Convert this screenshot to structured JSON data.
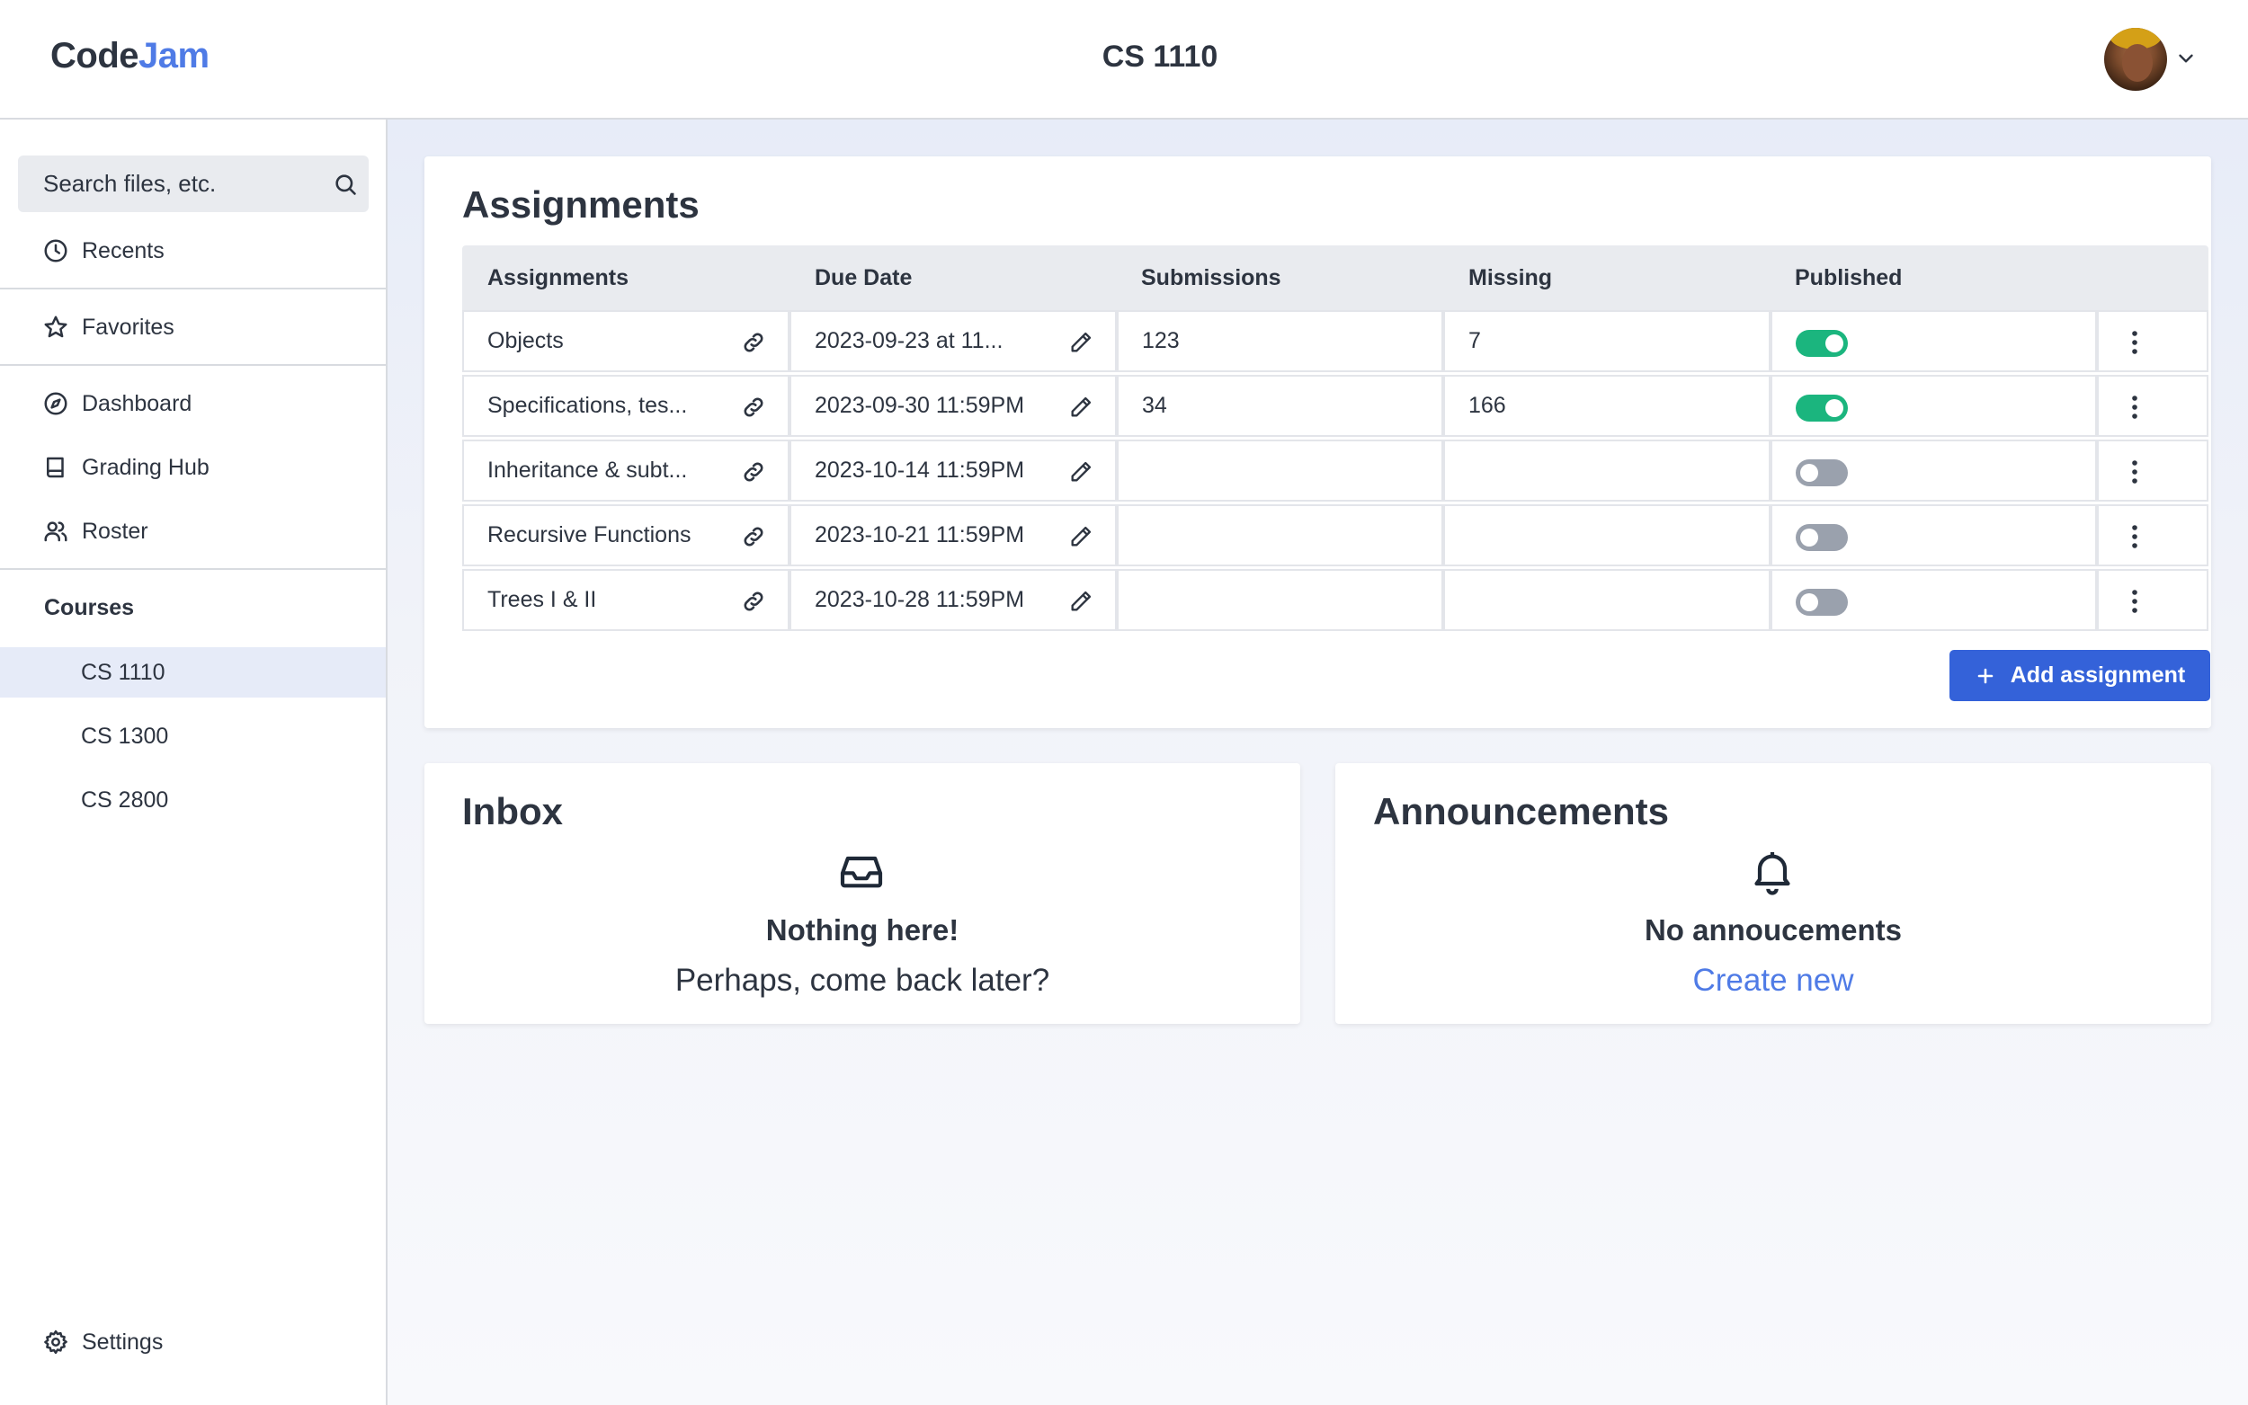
{
  "header": {
    "logo_part1": "Code",
    "logo_part2": "Jam",
    "course_title": "CS 1110"
  },
  "sidebar": {
    "search_placeholder": "Search files, etc.",
    "items": [
      {
        "label": "Recents",
        "icon": "clock-icon"
      },
      {
        "label": "Favorites",
        "icon": "star-icon"
      },
      {
        "label": "Dashboard",
        "icon": "compass-icon"
      },
      {
        "label": "Grading Hub",
        "icon": "book-icon"
      },
      {
        "label": "Roster",
        "icon": "users-icon"
      }
    ],
    "courses_label": "Courses",
    "courses": [
      "CS 1110",
      "CS 1300",
      "CS 2800"
    ],
    "active_course": "CS 1110",
    "settings_label": "Settings"
  },
  "assignments": {
    "title": "Assignments",
    "columns": [
      "Assignments",
      "Due Date",
      "Submissions",
      "Missing",
      "Published"
    ],
    "rows": [
      {
        "name": "Objects",
        "due": "2023-09-23 at 11...",
        "submissions": "123",
        "missing": "7",
        "published": true
      },
      {
        "name": "Specifications, tes...",
        "due": "2023-09-30 11:59PM",
        "submissions": "34",
        "missing": "166",
        "published": true
      },
      {
        "name": "Inheritance & subt...",
        "due": "2023-10-14 11:59PM",
        "submissions": "",
        "missing": "",
        "published": false
      },
      {
        "name": "Recursive Functions",
        "due": "2023-10-21 11:59PM",
        "submissions": "",
        "missing": "",
        "published": false
      },
      {
        "name": "Trees I & II",
        "due": "2023-10-28 11:59PM",
        "submissions": "",
        "missing": "",
        "published": false
      }
    ],
    "add_button": "Add assignment"
  },
  "inbox": {
    "title": "Inbox",
    "empty_title": "Nothing here!",
    "empty_sub": "Perhaps, come back later?"
  },
  "announcements": {
    "title": "Announcements",
    "empty_title": "No annoucements",
    "create_link": "Create new"
  },
  "colors": {
    "accent": "#3462d9",
    "logo_accent": "#4f7be6",
    "toggle_on": "#1bb57e",
    "toggle_off": "#9aa1ad"
  }
}
